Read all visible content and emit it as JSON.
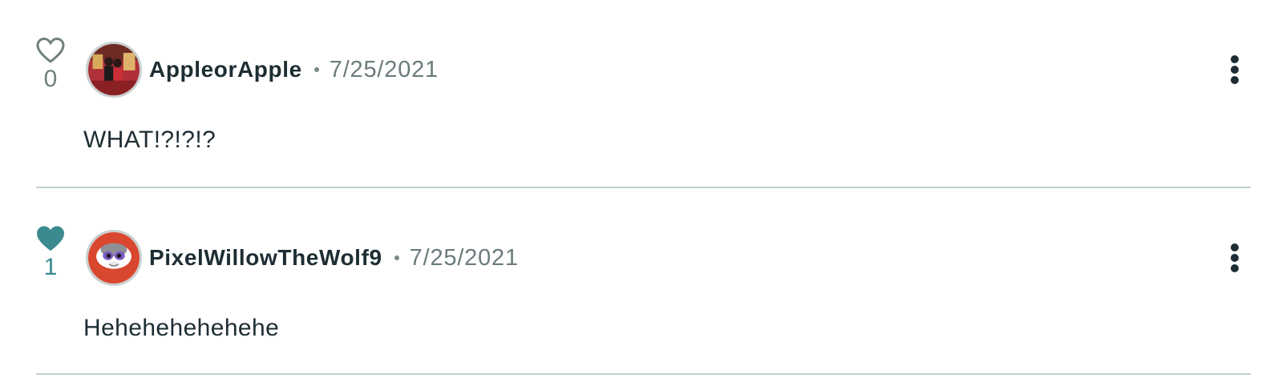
{
  "comments": [
    {
      "username": "AppleorApple",
      "date": "7/25/2021",
      "text": "WHAT!?!?!?",
      "likes": "0",
      "liked": false,
      "avatar": "photo-avatar"
    },
    {
      "username": "PixelWillowTheWolf9",
      "date": "7/25/2021",
      "text": "Hehehehehehehe",
      "likes": "1",
      "liked": true,
      "avatar": "wolf-avatar"
    }
  ],
  "colors": {
    "liked_heart": "#3a8a8e",
    "unliked_heart": "#70807f",
    "text": "#1d2d33",
    "muted": "#6b7b7d",
    "divider": "#c3cfce"
  },
  "icons": {
    "like": "heart-icon",
    "more": "more-vertical-icon"
  }
}
